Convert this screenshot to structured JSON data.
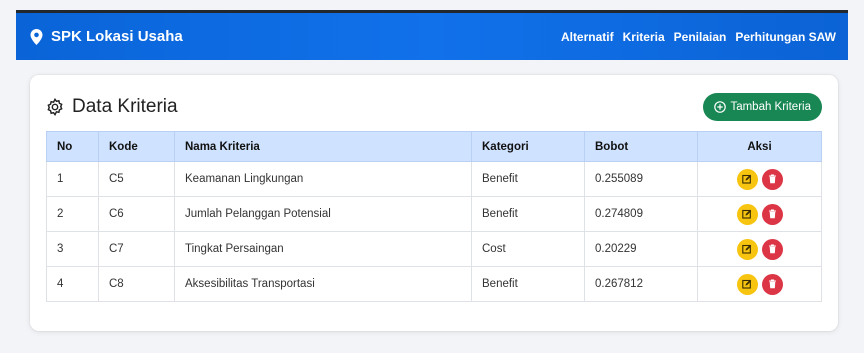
{
  "app": {
    "brand": "SPK Lokasi Usaha"
  },
  "nav": {
    "items": [
      "Alternatif",
      "Kriteria",
      "Penilaian",
      "Perhitungan SAW"
    ]
  },
  "page": {
    "title": "Data Kriteria",
    "add_button": "Tambah Kriteria"
  },
  "table": {
    "headers": [
      "No",
      "Kode",
      "Nama Kriteria",
      "Kategori",
      "Bobot",
      "Aksi"
    ],
    "rows": [
      {
        "no": "1",
        "kode": "C5",
        "nama": "Keamanan Lingkungan",
        "kategori": "Benefit",
        "bobot": "0.255089"
      },
      {
        "no": "2",
        "kode": "C6",
        "nama": "Jumlah Pelanggan Potensial",
        "kategori": "Benefit",
        "bobot": "0.274809"
      },
      {
        "no": "3",
        "kode": "C7",
        "nama": "Tingkat Persaingan",
        "kategori": "Cost",
        "bobot": "0.20229"
      },
      {
        "no": "4",
        "kode": "C8",
        "nama": "Aksesibilitas Transportasi",
        "kategori": "Benefit",
        "bobot": "0.267812"
      }
    ]
  },
  "icons": {
    "brand": "map-pin-icon",
    "title": "gear-icon",
    "add": "plus-circle-icon",
    "edit": "edit-icon",
    "delete": "trash-icon"
  },
  "colors": {
    "navbar": "#0b66dc",
    "add_button": "#198754",
    "table_header": "#cfe2ff",
    "edit": "#f7c40f",
    "delete": "#dc3545"
  }
}
